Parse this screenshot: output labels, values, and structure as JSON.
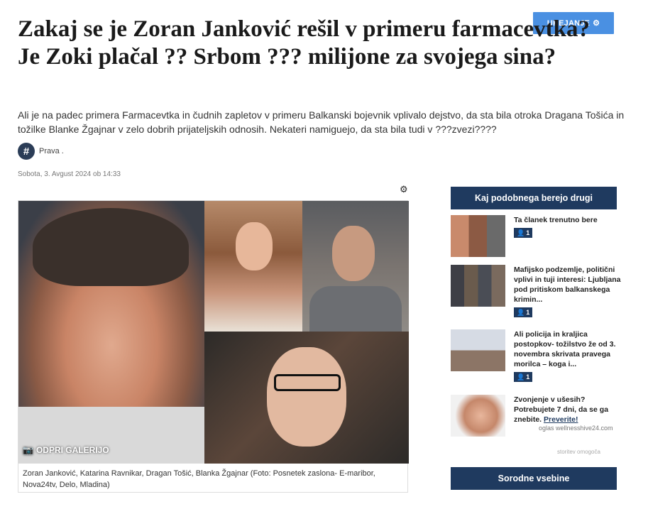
{
  "header": {
    "edit_button_label": "UREJANJE",
    "title": "Zakaj se je Zoran Janković rešil v primeru farmacevtka? Je Zoki plačal ?? Srbom ??? milijone za svojega sina?",
    "lead": "Ali je na padec primera Farmacevtka in čudnih zapletov v primeru Balkanski bojevnik vplivalo dejstvo, da sta bila otroka Dragana Tošića in tožilke Blanke Žgajnar v zelo dobrih prijateljskih odnosih. Nekateri namiguejo, da sta bila tudi v ???zvezi????"
  },
  "author": {
    "avatar_glyph": "#",
    "name": "Prava ."
  },
  "article": {
    "date": "Sobota, 3. Avgust 2024 ob 14:33"
  },
  "gallery": {
    "open_label": "ODPRI GALERIJO",
    "caption": "Zoran Janković, Katarina Ravnikar, Dragan Tošić, Blanka Žgajnar (Foto: Posnetek zaslona- E-maribor, Nova24tv, Delo, Mladina)"
  },
  "sidebar": {
    "header": "Kaj podobnega berejo drugi",
    "items": [
      {
        "title": "Ta članek trenutno bere",
        "readers": "1"
      },
      {
        "title": "Mafijsko podzemlje, politični vplivi in tuji interesi: Ljubljana pod pritiskom balkanskega kriminala...",
        "display": "Mafijsko podzemlje, politični vplivi in tuji interesi: Ljubljana pod pritiskom balkanskega krimin...",
        "readers": "1"
      },
      {
        "title": "Ali policija in kraljica postopkov- tožilstvo že od 3. novembra skrivata pravega morilca – koga i...",
        "readers": "1"
      }
    ],
    "ad": {
      "text": "Zvonjenje v ušesih? Potrebujete 7 dni, da se ga znebite.",
      "link": "Preverite!",
      "source": "oglas wellnesshive24.com"
    },
    "sponsor": "storitev omogoča",
    "related_button": "Sorodne vsebine"
  },
  "colors": {
    "accent": "#4a90e2",
    "navy": "#1f3a5f"
  }
}
